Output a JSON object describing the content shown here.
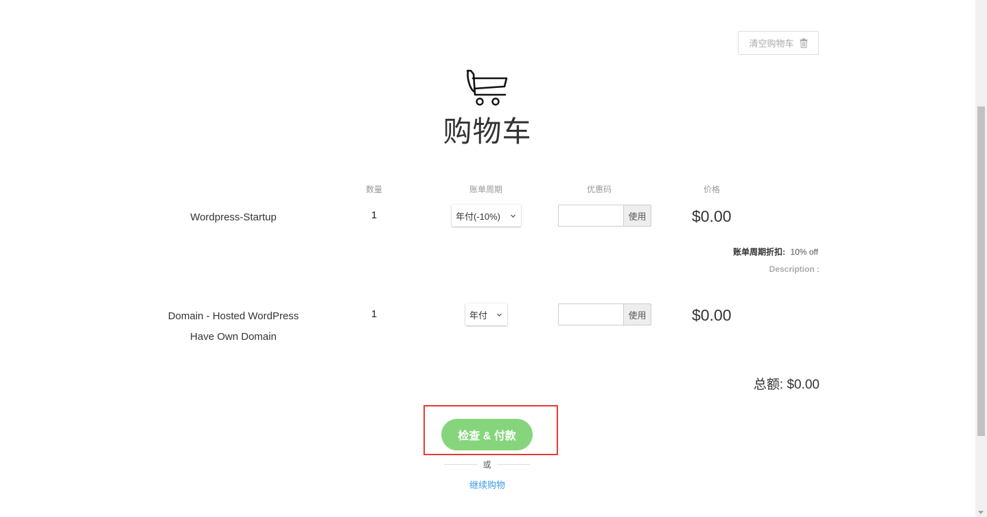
{
  "header": {
    "clear_cart_label": "清空购物车",
    "title": "购物车",
    "cart_icon": "shopping-cart-icon",
    "trash_icon": "trash-icon"
  },
  "columns": {
    "quantity": "数量",
    "billing_cycle": "账单周期",
    "promo_code": "优惠码",
    "price": "价格"
  },
  "items": [
    {
      "name": "Wordpress-Startup",
      "quantity": "1",
      "billing_cycle": "年付(-10%)",
      "promo_value": "",
      "apply_label": "使用",
      "price": "$0.00",
      "discount_label": "账单周期折扣:",
      "discount_value": "10% off",
      "description_label": "Description :"
    },
    {
      "name_line1": "Domain - Hosted WordPress",
      "name_line2": "Have Own Domain",
      "quantity": "1",
      "billing_cycle": "年付",
      "promo_value": "",
      "apply_label": "使用",
      "price": "$0.00"
    }
  ],
  "summary": {
    "total": "总额: $0.00"
  },
  "checkout": {
    "button_label": "检查 & 付款",
    "or_label": "或",
    "continue_label": "继续购物"
  },
  "colors": {
    "checkout_bg": "#86d57d",
    "link": "#3d9be9",
    "highlight": "#e53935"
  }
}
